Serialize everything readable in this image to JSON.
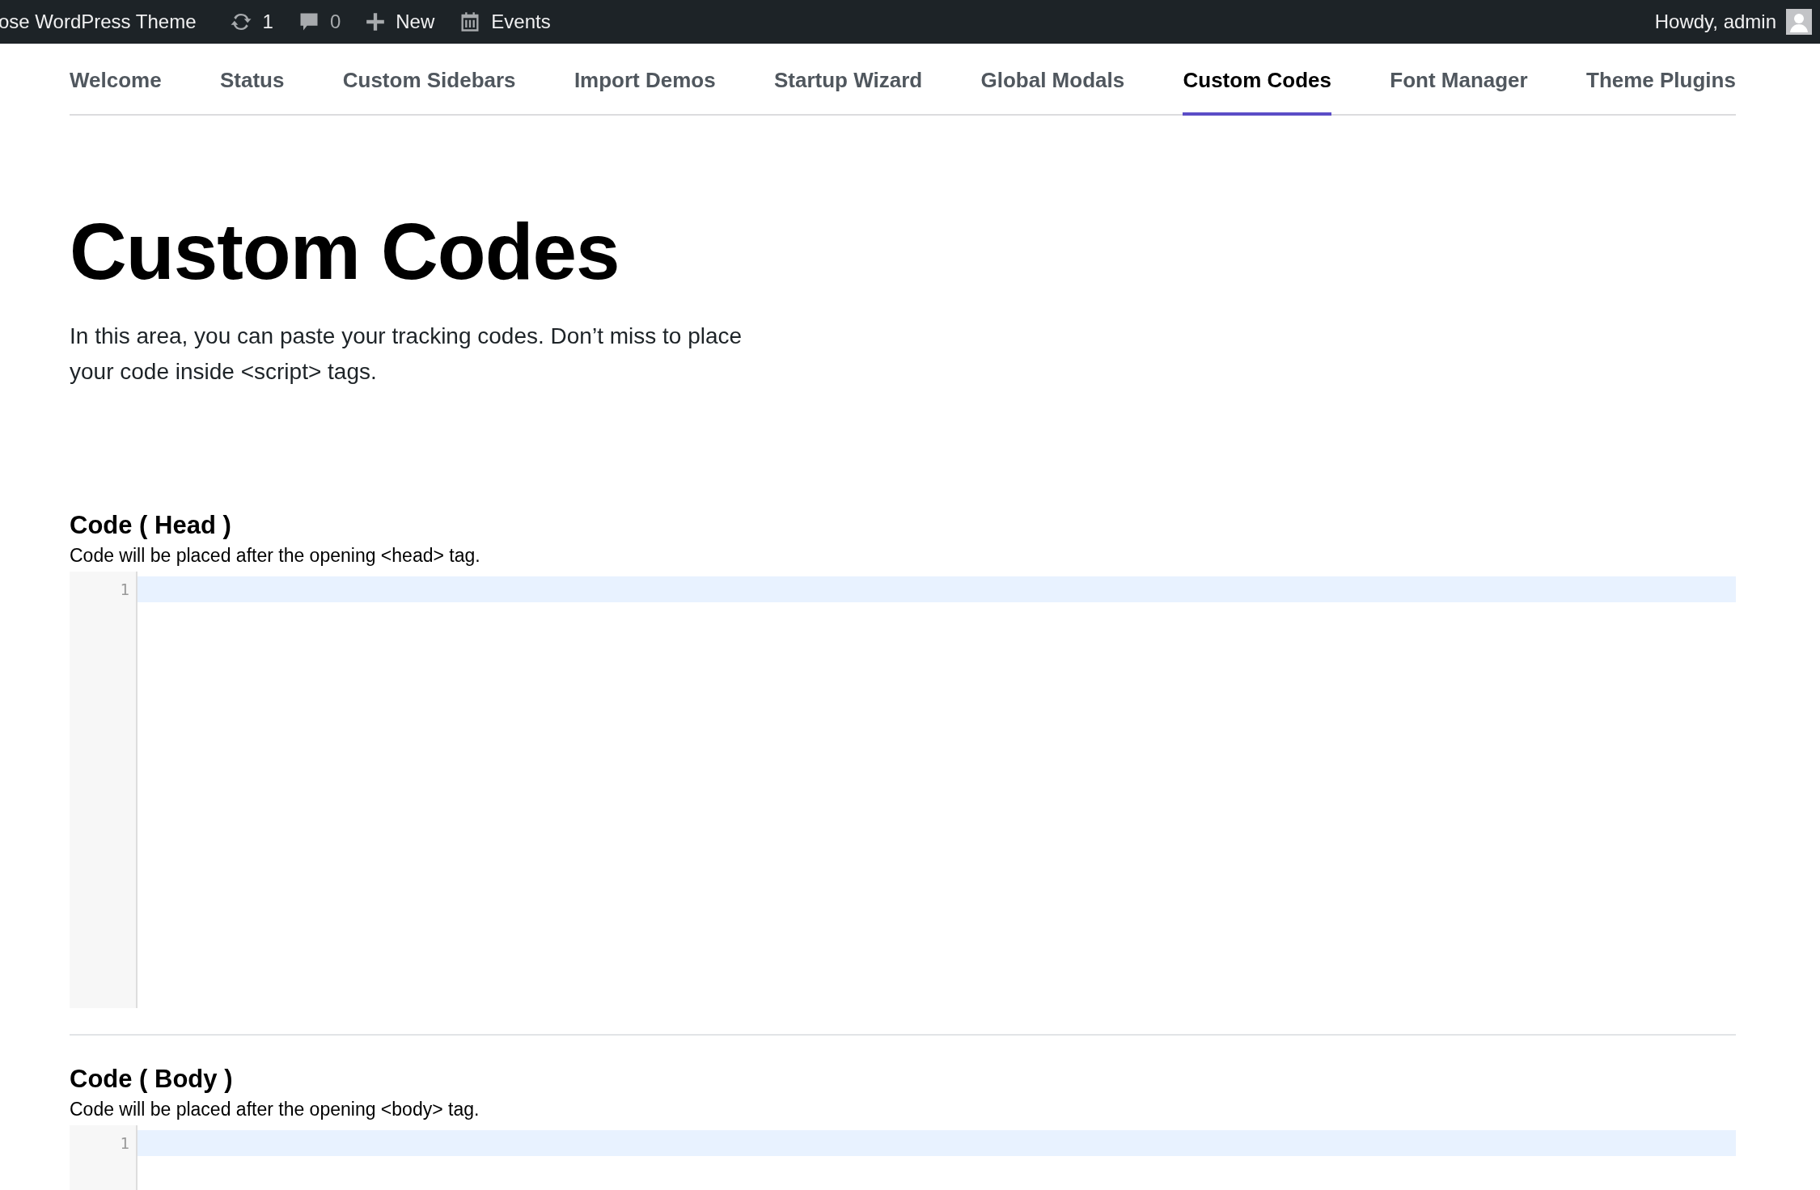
{
  "admin_bar": {
    "site_title": "ose WordPress Theme",
    "updates": {
      "count": "1"
    },
    "comments": {
      "count": "0"
    },
    "new": {
      "label": "New"
    },
    "events": {
      "label": "Events"
    },
    "greeting": "Howdy, admin"
  },
  "tabs": [
    {
      "label": "Welcome",
      "selected": false
    },
    {
      "label": "Status",
      "selected": false
    },
    {
      "label": "Custom Sidebars",
      "selected": false
    },
    {
      "label": "Import Demos",
      "selected": false
    },
    {
      "label": "Startup Wizard",
      "selected": false
    },
    {
      "label": "Global Modals",
      "selected": false
    },
    {
      "label": "Custom Codes",
      "selected": true
    },
    {
      "label": "Font Manager",
      "selected": false
    },
    {
      "label": "Theme Plugins",
      "selected": false
    }
  ],
  "heading": "Custom Codes",
  "description": "In this area, you can paste your tracking codes. Don’t miss to place your code inside <script> tags.",
  "code_sections": [
    {
      "title": "Code ( Head )",
      "description": "Code will be placed after the opening <head> tag.",
      "line_numbers": [
        "1"
      ]
    },
    {
      "title": "Code ( Body )",
      "description": "Code will be placed after the opening <body> tag.",
      "line_numbers": [
        "1"
      ]
    }
  ]
}
